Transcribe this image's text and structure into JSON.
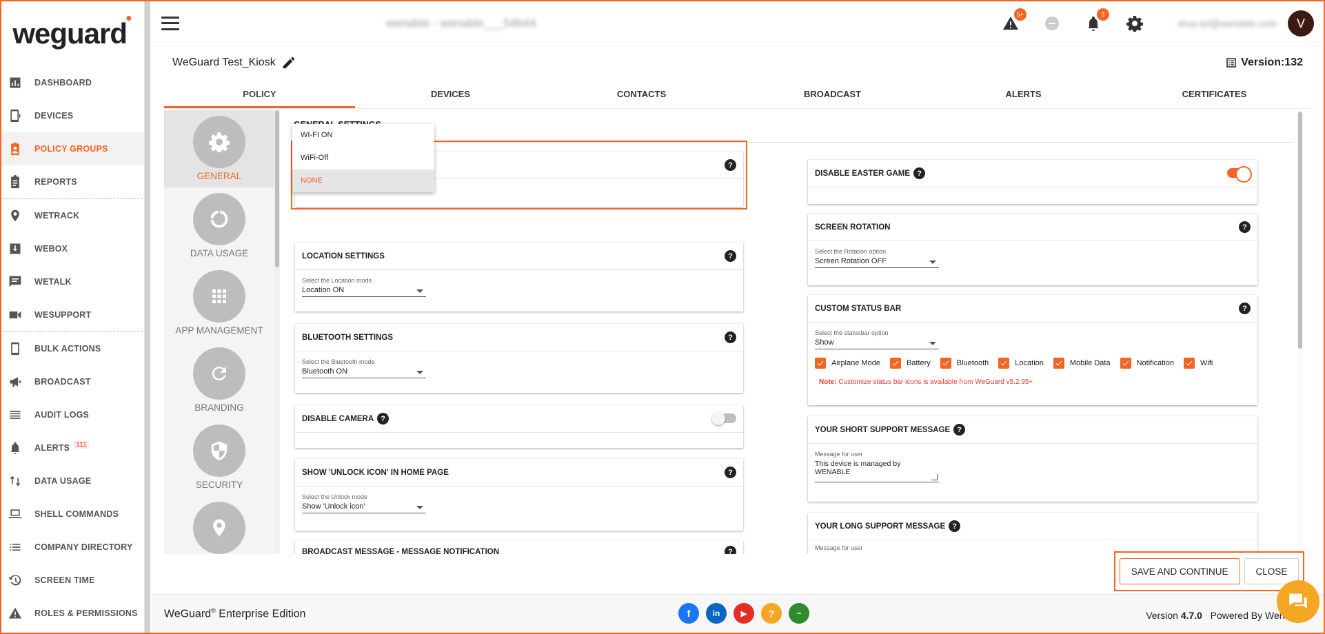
{
  "header": {
    "account_blurred": "wenable - wenable___54b44",
    "alerts_badge": "5+",
    "notif_badge": "3",
    "user_blurred": "drue.tel@wenable.com",
    "avatar_initial": "V"
  },
  "logo": {
    "text": "weguard"
  },
  "sidebar": {
    "items": [
      {
        "label": "DASHBOARD"
      },
      {
        "label": "DEVICES"
      },
      {
        "label": "POLICY GROUPS"
      },
      {
        "label": "REPORTS"
      },
      {
        "label": "WETRACK"
      },
      {
        "label": "WEBOX"
      },
      {
        "label": "WETALK"
      },
      {
        "label": "WESUPPORT"
      },
      {
        "label": "BULK ACTIONS"
      },
      {
        "label": "BROADCAST"
      },
      {
        "label": "AUDIT LOGS"
      },
      {
        "label": "ALERTS",
        "badge": "111"
      },
      {
        "label": "DATA USAGE"
      },
      {
        "label": "SHELL COMMANDS"
      },
      {
        "label": "COMPANY DIRECTORY"
      },
      {
        "label": "SCREEN TIME"
      },
      {
        "label": "ROLES & PERMISSIONS"
      }
    ],
    "active": "POLICY GROUPS"
  },
  "page": {
    "title": "WeGuard Test_Kiosk",
    "version": "Version:132"
  },
  "tabs": [
    "POLICY",
    "DEVICES",
    "CONTACTS",
    "BROADCAST",
    "ALERTS",
    "CERTIFICATES"
  ],
  "categories": [
    {
      "label": "GENERAL",
      "icon": "gear-icon"
    },
    {
      "label": "DATA USAGE",
      "icon": "donut-icon"
    },
    {
      "label": "APP MANAGEMENT",
      "icon": "grid-icon"
    },
    {
      "label": "BRANDING",
      "icon": "refresh-icon"
    },
    {
      "label": "SECURITY",
      "icon": "shield-icon"
    },
    {
      "label": "",
      "icon": "location-pin-icon"
    }
  ],
  "general": {
    "title": "GENERAL SETTINGS",
    "wifi_dropdown": {
      "options": [
        "WI-FI ON",
        "WiFi-Off",
        "NONE"
      ],
      "selected": "NONE"
    },
    "location": {
      "title": "LOCATION SETTINGS",
      "label": "Select the Location mode",
      "value": "Location ON"
    },
    "bluetooth": {
      "title": "BLUETOOTH SETTINGS",
      "label": "Select the Bluetooth mode",
      "value": "Bluetooth ON"
    },
    "camera": {
      "title": "DISABLE CAMERA"
    },
    "unlock": {
      "title": "SHOW 'UNLOCK ICON' IN HOME PAGE",
      "label": "Select the Unlock mode",
      "value": "Show 'Unlock icon'"
    },
    "broadcast": {
      "title": "BROADCAST MESSAGE - MESSAGE NOTIFICATION"
    },
    "easter": {
      "title": "DISABLE EASTER GAME"
    },
    "rotation": {
      "title": "SCREEN ROTATION",
      "label": "Select the Rotation option",
      "value": "Screen Rotation OFF"
    },
    "statusbar": {
      "title": "CUSTOM STATUS BAR",
      "label": "Select the statusbar option",
      "value": "Show",
      "checks": [
        "Airplane Mode",
        "Battery",
        "Bluetooth",
        "Location",
        "Mobile Data",
        "Notification",
        "Wifi"
      ],
      "note_prefix": "Note:",
      "note": " Customize status bar icons is available from WeGuard v5.2.95+"
    },
    "short_msg": {
      "title": "YOUR SHORT SUPPORT MESSAGE",
      "label": "Message for user",
      "line1": "This device is managed by",
      "line2": "WENABLE"
    },
    "long_msg": {
      "title": "YOUR LONG SUPPORT MESSAGE",
      "label": "Message for user"
    }
  },
  "actions": {
    "save": "SAVE AND CONTINUE",
    "close": "CLOSE"
  },
  "footer": {
    "brand": "WeGuard",
    "reg": "®",
    "edition": " Enterprise Edition",
    "version_label": "Version ",
    "version": "4.7.0",
    "powered": "   Powered By Wenable"
  }
}
